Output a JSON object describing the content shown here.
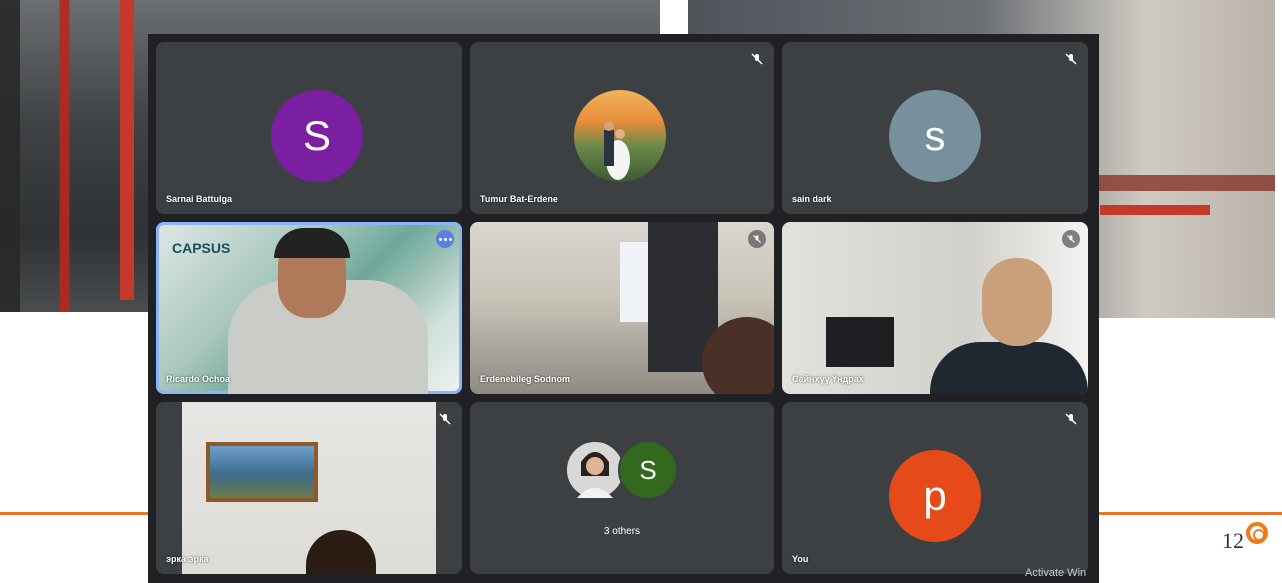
{
  "slide": {
    "page_number": "12",
    "accent_color": "#e8762a"
  },
  "meet": {
    "tiles": [
      {
        "name": "Sarnai Battulga",
        "avatar_letter": "S",
        "avatar_color": "#7b1fa2",
        "muted": false
      },
      {
        "name": "Tumur Bat-Erdene",
        "avatar_type": "photo",
        "muted": true
      },
      {
        "name": "sain dark",
        "avatar_letter": "s",
        "avatar_color": "#78909c",
        "muted": true
      },
      {
        "name": "Ricardo Ochoa",
        "video": true,
        "logo_text": "CAPSUS",
        "active_speaker": true
      },
      {
        "name": "Erdenebileg Sodnom",
        "video": true,
        "muted": true
      },
      {
        "name": "Сайнхүү Үндрах",
        "video": true,
        "muted": true
      },
      {
        "name": "эрка эрка",
        "video": true,
        "muted": true
      },
      {
        "name": "3 others",
        "avatar_letter": "S",
        "avatar_color": "#33691e"
      },
      {
        "name": "You",
        "avatar_letter": "p",
        "avatar_color": "#e64a19",
        "muted": true
      }
    ]
  },
  "watermark": "Activate Win"
}
